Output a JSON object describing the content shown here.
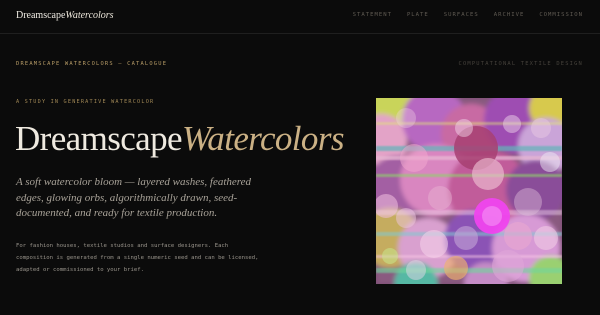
{
  "nav": {
    "brand_main": "Dreamscape",
    "brand_accent": "Watercolors",
    "links": [
      "STATEMENT",
      "PLATE",
      "SURFACES",
      "ARCHIVE",
      "COMMISSION"
    ]
  },
  "header": {
    "catalogue": "DREAMSCAPE WATERCOLORS — CATALOGUE",
    "category": "COMPUTATIONAL TEXTILE DESIGN"
  },
  "hero": {
    "eyebrow": "A STUDY IN GENERATIVE WATERCOLOR",
    "title_main": "Dreamscape",
    "title_accent": "Watercolors",
    "lede": "A soft watercolor bloom — layered washes, feathered edges, glowing orbs, algorithmically drawn, seed-documented, and ready for textile production.",
    "body": "For fashion houses, textile studios and surface designers. Each composition is generated from a single numeric seed and can be licensed, adapted or commissioned to your brief."
  },
  "colors": {
    "background": "#0b0b0b",
    "accent_gold": "#cbb185",
    "mono_gold": "#b69b66"
  }
}
